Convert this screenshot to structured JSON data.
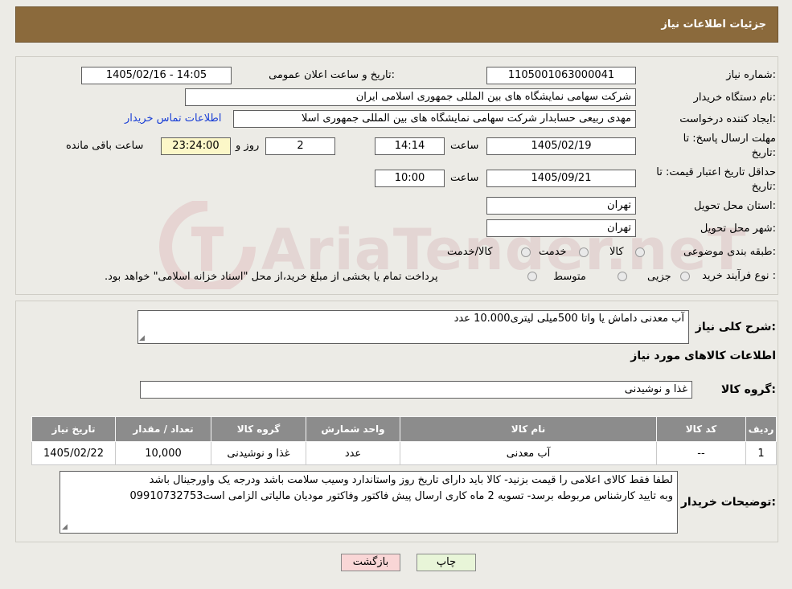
{
  "header": {
    "title": "جزئیات اطلاعات نیاز"
  },
  "watermark": {
    "text": "AriaTender.neT"
  },
  "form": {
    "need_number": {
      "label": "شماره نیاز:",
      "value": "1105001063000041"
    },
    "announce": {
      "label": "تاریخ و ساعت اعلان عمومی:",
      "value": "1405/02/16 - 14:05"
    },
    "buyer_org": {
      "label": "نام دستگاه خریدار:",
      "value": "شرکت سهامی نمایشگاه های بین المللی جمهوری اسلامی ایران"
    },
    "requester": {
      "label": "ایجاد کننده درخواست:",
      "value": "مهدی  ربیعی حسابدار شرکت سهامی نمایشگاه های بین المللی جمهوری اسلا",
      "contact_link": "اطلاعات تماس خریدار"
    },
    "deadline": {
      "label_line1": "مهلت ارسال پاسخ: تا",
      "label_line2": "تاریخ:",
      "date": "1405/02/19",
      "time_label": "ساعت",
      "time": "14:14",
      "days": "2",
      "days_label": "روز و",
      "remaining": "23:24:00",
      "remaining_label": "ساعت باقی مانده"
    },
    "price_validity": {
      "label_line1": "حداقل تاریخ اعتبار قیمت: تا",
      "label_line2": "تاریخ:",
      "date": "1405/09/21",
      "time_label": "ساعت",
      "time": "10:00"
    },
    "province": {
      "label": "استان محل تحویل:",
      "value": "تهران"
    },
    "city": {
      "label": "شهر محل تحویل:",
      "value": "تهران"
    },
    "category": {
      "label": "طبقه بندی موضوعی:",
      "options": [
        "کالا",
        "خدمت",
        "کالا/خدمت"
      ]
    },
    "process": {
      "label": "نوع فرآیند خرید :",
      "options": [
        "جزیی",
        "متوسط"
      ],
      "note": "پرداخت تمام یا بخشی از مبلغ خرید،از محل \"اسناد خزانه اسلامی\" خواهد بود."
    }
  },
  "summary": {
    "label": "شرح کلی نیاز:",
    "value": "آب معدنی داماش یا واتا 500میلی لیتری10.000 عدد",
    "goods_title": "اطلاعات کالاهای مورد نیاز",
    "group_label": "گروه کالا:",
    "group_value": "غذا و نوشیدنی"
  },
  "table": {
    "headers": [
      "ردیف",
      "کد کالا",
      "نام کالا",
      "واحد شمارش",
      "گروه کالا",
      "تعداد / مقدار",
      "تاریخ نیاز"
    ],
    "rows": [
      [
        "1",
        "--",
        "آب معدنی",
        "عدد",
        "غذا و نوشیدنی",
        "10,000",
        "1405/02/22"
      ]
    ]
  },
  "buyer_notes": {
    "label": "توضیحات خریدار:",
    "line1": "لطفا فقط کالای اعلامی را قیمت بزنید- کالا باید دارای تاریخ روز واستاندارد وسیب سلامت باشد ودرجه یک واورجینال باشد",
    "line2": "وبه تایید کارشناس مربوطه برسد- تسویه 2 ماه کاری ارسال پیش فاکتور وفاکتور مودیان مالیاتی الزامی است09910732753"
  },
  "buttons": {
    "print": "چاپ",
    "back": "بازگشت"
  },
  "colors": {
    "header": "#8b6a3c",
    "table_header": "#8c8c8c",
    "link": "#1a3fd6",
    "back_button": "#f9d6d6"
  }
}
